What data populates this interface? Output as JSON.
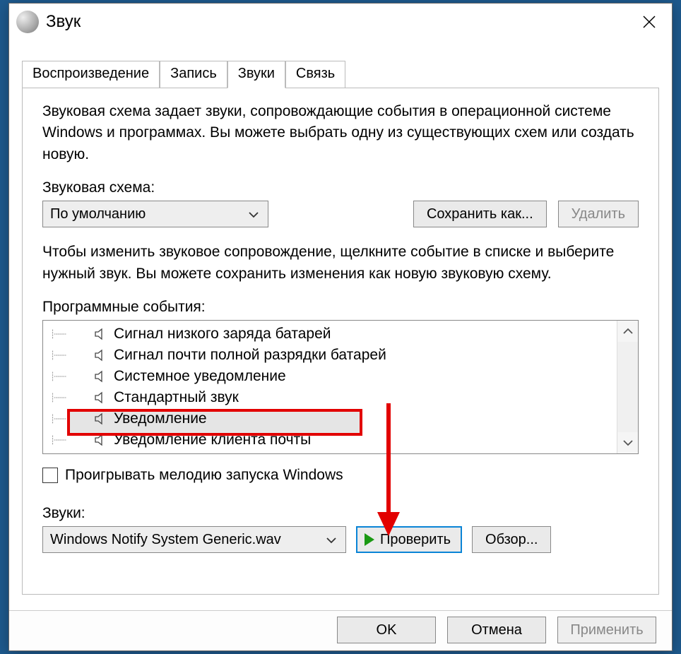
{
  "window": {
    "title": "Звук",
    "close_icon": "close"
  },
  "tabs": [
    {
      "label": "Воспроизведение",
      "active": false
    },
    {
      "label": "Запись",
      "active": false
    },
    {
      "label": "Звуки",
      "active": true
    },
    {
      "label": "Связь",
      "active": false
    }
  ],
  "description": "Звуковая схема задает звуки, сопровождающие события в операционной системе Windows и программах. Вы можете выбрать одну из существующих схем или создать новую.",
  "scheme": {
    "label": "Звуковая схема:",
    "value": "По умолчанию",
    "save_as": "Сохранить как...",
    "delete": "Удалить"
  },
  "events_help": "Чтобы изменить звуковое сопровождение, щелкните событие в списке и выберите нужный звук. Вы можете сохранить изменения как новую звуковую схему.",
  "events_label": "Программные события:",
  "events": [
    {
      "label": "Сигнал низкого заряда батарей",
      "selected": false
    },
    {
      "label": "Сигнал почти полной разрядки батарей",
      "selected": false
    },
    {
      "label": "Системное уведомление",
      "selected": false
    },
    {
      "label": "Стандартный звук",
      "selected": false
    },
    {
      "label": "Уведомление",
      "selected": true
    },
    {
      "label": "Уведомление клиента почты",
      "selected": false
    }
  ],
  "startup_check": {
    "label": "Проигрывать мелодию запуска Windows",
    "checked": false
  },
  "sounds": {
    "label": "Звуки:",
    "value": "Windows Notify System Generic.wav",
    "test": "Проверить",
    "browse": "Обзор..."
  },
  "buttons": {
    "ok": "OK",
    "cancel": "Отмена",
    "apply": "Применить"
  }
}
